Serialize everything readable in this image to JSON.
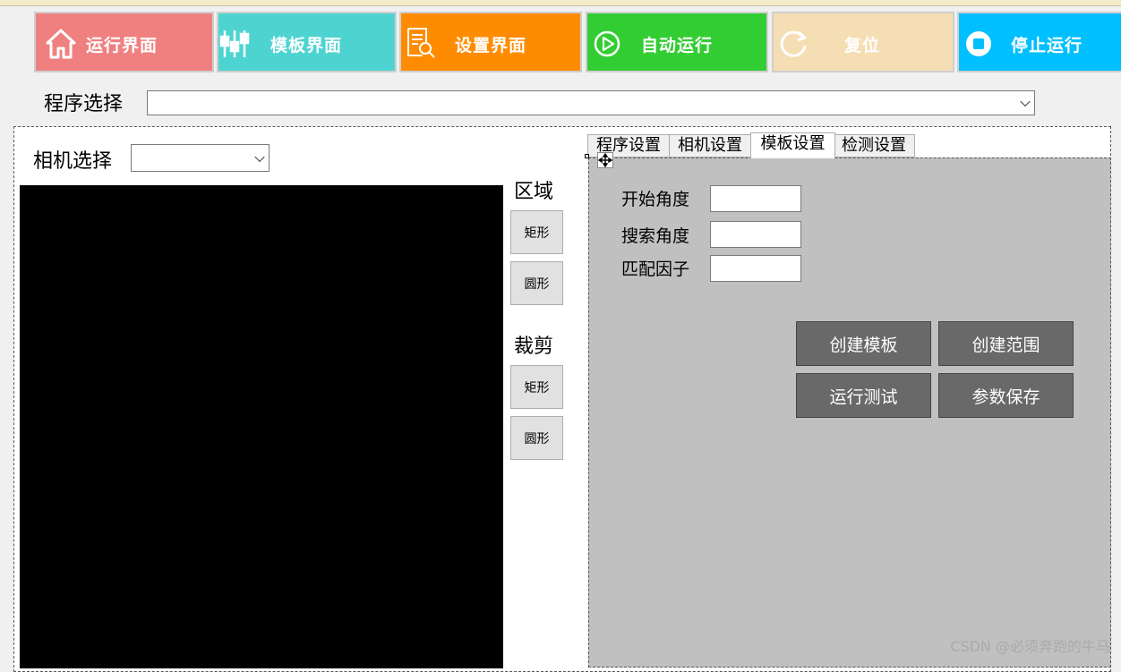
{
  "nav": [
    {
      "label": "运行界面",
      "color": "#f08080",
      "icon": "home-icon"
    },
    {
      "label": "模板界面",
      "color": "#4ed4d0",
      "icon": "sliders-icon"
    },
    {
      "label": "设置界面",
      "color": "#ff8c00",
      "icon": "document-search-icon"
    },
    {
      "label": "自动运行",
      "color": "#32cd32",
      "icon": "play-circle-icon"
    },
    {
      "label": "复位",
      "color": "#f5deb3",
      "icon": "reset-icon"
    },
    {
      "label": "停止运行",
      "color": "#00bfff",
      "icon": "stop-icon"
    }
  ],
  "program": {
    "label": "程序选择",
    "value": ""
  },
  "camera": {
    "label": "相机选择",
    "value": ""
  },
  "region": {
    "label": "区域",
    "rect": "矩形",
    "circle": "圆形"
  },
  "crop": {
    "label": "裁剪",
    "rect": "矩形",
    "circle": "圆形"
  },
  "tabs": [
    {
      "label": "程序设置"
    },
    {
      "label": "相机设置"
    },
    {
      "label": "模板设置",
      "active": true
    },
    {
      "label": "检测设置"
    }
  ],
  "template_settings": {
    "fields": [
      {
        "label": "开始角度",
        "value": ""
      },
      {
        "label": "搜索角度",
        "value": ""
      },
      {
        "label": "匹配因子",
        "value": ""
      }
    ],
    "buttons": {
      "create_template": "创建模板",
      "create_range": "创建范围",
      "run_test": "运行测试",
      "save_params": "参数保存"
    }
  },
  "watermark": "CSDN @必须奔跑的牛马"
}
